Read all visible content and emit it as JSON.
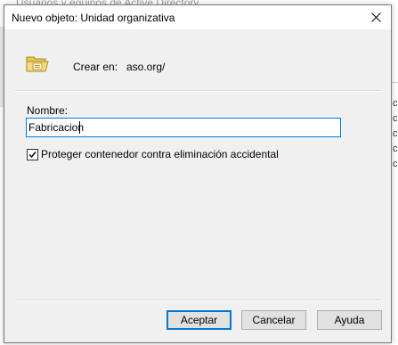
{
  "background": {
    "title": "Usuarios y equipos de Active Directory",
    "right_column": [
      "co",
      "co",
      "co",
      "co",
      "co"
    ]
  },
  "dialog": {
    "title": "Nuevo objeto: Unidad organizativa",
    "create_in_label": "Crear en:",
    "create_in_value": "aso.org/",
    "name_label": "Nombre:",
    "name_value": "Fabricacion",
    "protect_checkbox_label": "Proteger contenedor contra eliminación accidental",
    "protect_checked": true,
    "buttons": {
      "ok": "Aceptar",
      "cancel": "Cancelar",
      "help": "Ayuda"
    },
    "icons": {
      "close": "close-icon",
      "folder": "organizational-unit-folder-icon"
    },
    "accent_color": "#0078d7"
  }
}
